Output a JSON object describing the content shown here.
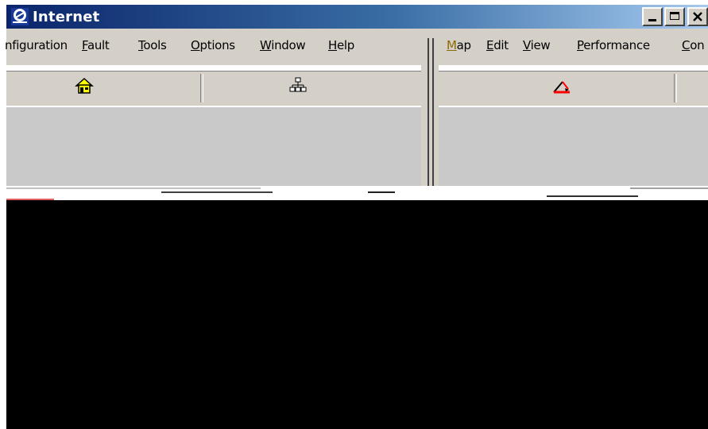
{
  "window": {
    "title": "Internet",
    "caption_buttons": [
      "minimize",
      "maximize",
      "close"
    ]
  },
  "menubar_left": [
    {
      "label": "nfiguration",
      "underline": "",
      "rest": "nfiguration"
    },
    {
      "label": "Fault",
      "underline": "F",
      "rest": "ault"
    },
    {
      "label": "Tools",
      "underline": "T",
      "rest": "ools"
    },
    {
      "label": "Options",
      "underline": "O",
      "rest": "ptions"
    },
    {
      "label": "Window",
      "underline": "W",
      "rest": "indow"
    },
    {
      "label": "Help",
      "underline": "H",
      "rest": "elp"
    }
  ],
  "menubar_right": [
    {
      "label": "Map",
      "underline": "M",
      "rest": "ap"
    },
    {
      "label": "Edit",
      "underline": "E",
      "rest": "dit"
    },
    {
      "label": "View",
      "underline": "V",
      "rest": "iew"
    },
    {
      "label": "Performance",
      "underline": "P",
      "rest": "erformance"
    },
    {
      "label": "Con",
      "underline": "C",
      "rest": "on"
    }
  ],
  "toolbar_icons": [
    "home-icon",
    "network-tree-icon",
    "edit-triangle-icon"
  ],
  "colors": {
    "titlebar_start": "#0a246a",
    "titlebar_end": "#a6caf0",
    "face": "#d4d0c8",
    "pane": "#c9c9c9"
  }
}
